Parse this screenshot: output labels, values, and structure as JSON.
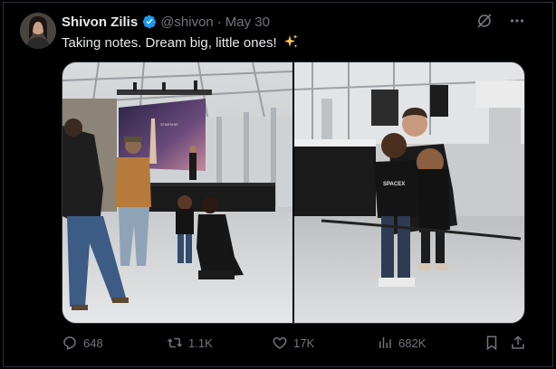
{
  "author": {
    "name": "Shivon Zilis",
    "handle": "@shivon",
    "separator": "·",
    "date": "May 30"
  },
  "post": {
    "text": "Taking notes. Dream big, little ones!"
  },
  "photos": [
    {
      "slide_text": "STARSHIP"
    },
    {
      "shirt_text": "SPACEX"
    }
  ],
  "actions": {
    "replies": "648",
    "reposts": "1.1K",
    "likes": "17K",
    "views": "682K"
  },
  "icons": {
    "verified": "verified-badge-icon",
    "grok": "grok-icon",
    "more": "more-icon",
    "reply": "reply-icon",
    "repost": "repost-icon",
    "like": "heart-icon",
    "views": "views-chart-icon",
    "bookmark": "bookmark-icon",
    "share": "share-icon"
  },
  "colors": {
    "background": "#000000",
    "text": "#e7e9ea",
    "secondary": "#71767b",
    "verified": "#1d9bf0",
    "border": "#2f3336"
  }
}
